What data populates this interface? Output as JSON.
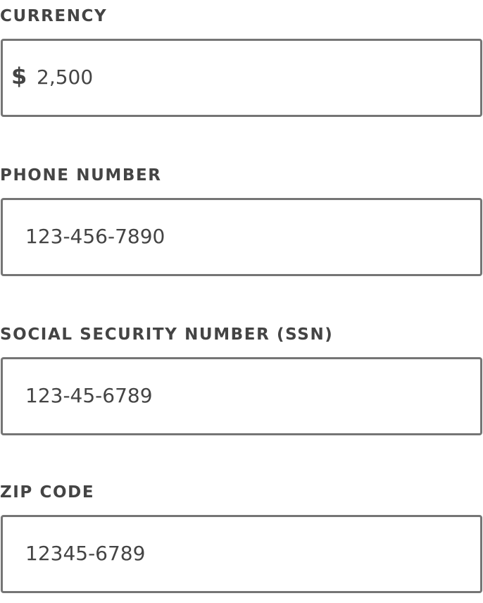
{
  "fields": [
    {
      "label": "CURRENCY",
      "prefix": "$",
      "value": "2,500"
    },
    {
      "label": "PHONE NUMBER",
      "value": "123-456-7890"
    },
    {
      "label": "SOCIAL SECURITY NUMBER (SSN)",
      "value": "123-45-6789"
    },
    {
      "label": "ZIP CODE",
      "value": "12345-6789"
    }
  ],
  "colors": {
    "text": "#444444",
    "border": "#757575",
    "background": "#ffffff"
  }
}
